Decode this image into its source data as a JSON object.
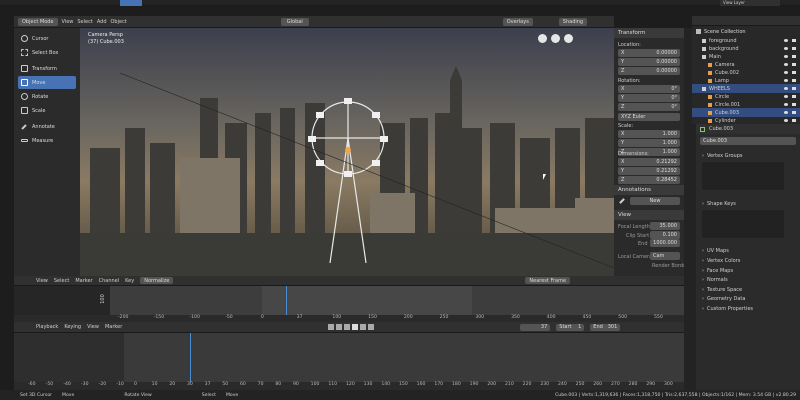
{
  "topbar": {
    "mode": "Object Mode",
    "menus": [
      "View",
      "Select",
      "Add",
      "Object"
    ],
    "orientation": "Global",
    "overlays": "Overlays",
    "shading": "Shading",
    "view_layer": "View Layer"
  },
  "tools": [
    "Cursor",
    "Select Box",
    "Transform",
    "Move",
    "Rotate",
    "Scale",
    "Annotate",
    "Measure"
  ],
  "viewport": {
    "camera_label": "Camera Persp",
    "object_label": "(37) Cube.003"
  },
  "npanel": {
    "transform_header": "Transform",
    "location_label": "Location:",
    "location": [
      {
        "axis": "X",
        "value": "0.00000"
      },
      {
        "axis": "Y",
        "value": "0.00000"
      },
      {
        "axis": "Z",
        "value": "0.00000"
      }
    ],
    "rotation_label": "Rotation:",
    "rotation": [
      {
        "axis": "X",
        "value": "0°"
      },
      {
        "axis": "Y",
        "value": "0°"
      },
      {
        "axis": "Z",
        "value": "0°"
      }
    ],
    "euler": "XYZ Euler",
    "scale_label": "Scale:",
    "scale": [
      {
        "axis": "X",
        "value": "1.000"
      },
      {
        "axis": "Y",
        "value": "1.000"
      },
      {
        "axis": "Z",
        "value": "1.000"
      }
    ],
    "dimensions_label": "Dimensions:",
    "dimensions": [
      {
        "axis": "X",
        "value": "0.21292"
      },
      {
        "axis": "Y",
        "value": "0.21292"
      },
      {
        "axis": "Z",
        "value": "0.28452"
      }
    ],
    "annotations_header": "Annotations",
    "annotation_new": "New",
    "view_header": "View",
    "focal_label": "Focal Length",
    "focal_value": "35.000",
    "clip_start_label": "Clip Start",
    "clip_start_value": "0.100",
    "end_label": "End",
    "end_value": "1000.000",
    "local_camera_label": "Local Camera",
    "local_camera_value": "Cam",
    "render_border": "Render Border"
  },
  "outliner": {
    "title": "Scene Collection",
    "items": [
      {
        "name": "foreground",
        "indent": 1
      },
      {
        "name": "background",
        "indent": 1
      },
      {
        "name": "Main",
        "indent": 1
      },
      {
        "name": "Camera",
        "indent": 2
      },
      {
        "name": "Cube.002",
        "indent": 2
      },
      {
        "name": "Lamp",
        "indent": 2
      },
      {
        "name": "WHEELS",
        "indent": 1
      },
      {
        "name": "Circle",
        "indent": 2
      },
      {
        "name": "Circle.001",
        "indent": 2
      },
      {
        "name": "Cube.003",
        "indent": 2
      },
      {
        "name": "Cylinder",
        "indent": 2
      }
    ]
  },
  "properties": {
    "object_name": "Cube.003",
    "search_value": "Cube.003",
    "sections": [
      "Vertex Groups",
      "Shape Keys",
      "UV Maps",
      "Vertex Colors",
      "Face Maps",
      "Normals",
      "Texture Space",
      "Geometry Data",
      "Custom Properties"
    ]
  },
  "graph": {
    "menus": [
      "View",
      "Select",
      "Marker",
      "Channel",
      "Key"
    ],
    "normalize": "Normalize",
    "interp": "Nearest Frame",
    "y_label": "100",
    "ticks": [
      "-200",
      "-150",
      "-100",
      "-50",
      "0",
      "37",
      "100",
      "150",
      "200",
      "250",
      "300",
      "350",
      "400",
      "450",
      "500",
      "550"
    ]
  },
  "timeline": {
    "menus": [
      "Playback",
      "Keying",
      "View",
      "Marker"
    ],
    "current_frame": "37",
    "start_label": "Start",
    "start_value": "1",
    "end_label": "End",
    "end_value": "301",
    "ticks": [
      "-60",
      "-50",
      "-40",
      "-30",
      "-20",
      "-10",
      "0",
      "10",
      "20",
      "30",
      "37",
      "50",
      "60",
      "70",
      "80",
      "90",
      "100",
      "110",
      "120",
      "130",
      "140",
      "150",
      "160",
      "170",
      "180",
      "190",
      "200",
      "210",
      "220",
      "230",
      "240",
      "250",
      "260",
      "270",
      "280",
      "290",
      "300"
    ]
  },
  "statusbar": {
    "items": [
      "Set 3D Cursor",
      "Move",
      "Rotate View",
      "Select",
      "Move"
    ],
    "stats": "Cube.003 | Verts:1,319,636 | Faces:1,318,750 | Tris:2,637,558 | Objects:1/162 | Mem: 3.54 GB | v2.80.29"
  },
  "colors": {
    "accent": "#4772b3",
    "playhead": "#4a8bd6",
    "panel": "#303030"
  }
}
